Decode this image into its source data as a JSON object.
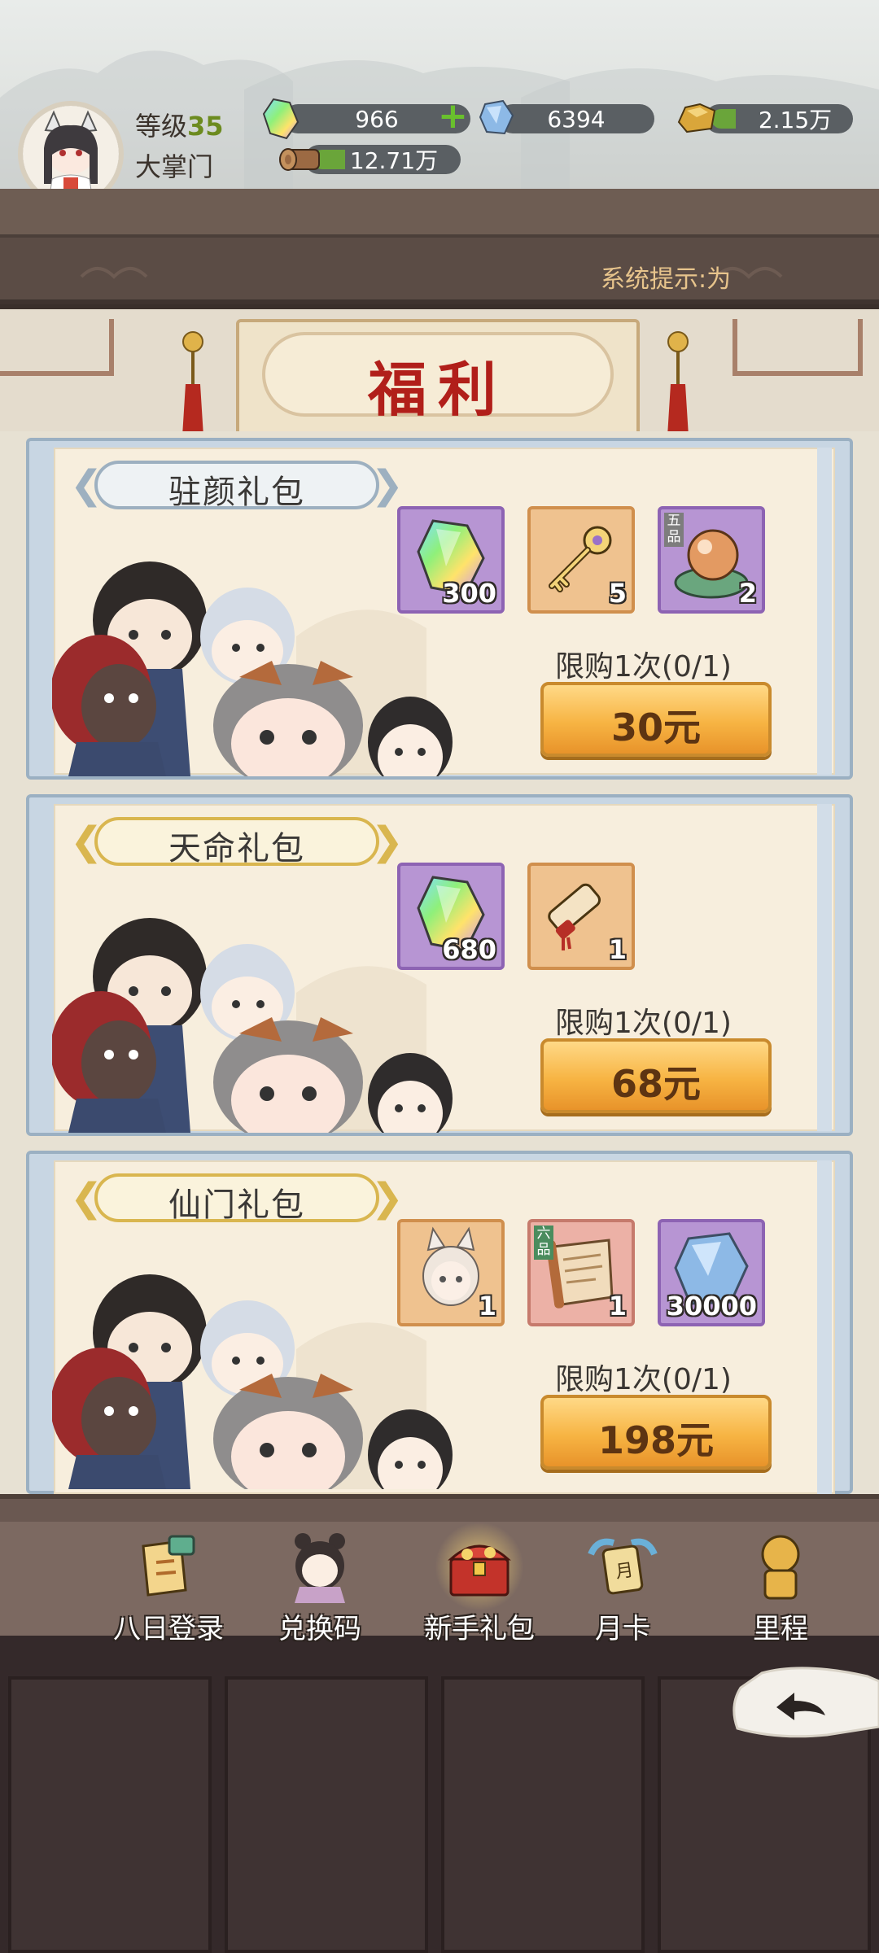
{
  "header": {
    "level_label": "等级",
    "level_value": "35",
    "player_title": "大掌门",
    "resources": {
      "gem": "966",
      "crystal": "6394",
      "gold": "2.15万",
      "wood": "12.71万"
    },
    "system_notice": "系统提示:为"
  },
  "page_title": "福利",
  "packs": [
    {
      "name": "驻颜礼包",
      "items": [
        {
          "icon": "rainbow-gem-icon",
          "count": "300"
        },
        {
          "icon": "golden-key-icon",
          "count": "5"
        },
        {
          "icon": "pearl-orb-icon",
          "count": "2",
          "grade": "五品"
        }
      ],
      "limit": "限购1次(0/1)",
      "price": "30元"
    },
    {
      "name": "天命礼包",
      "items": [
        {
          "icon": "rainbow-gem-icon",
          "count": "680"
        },
        {
          "icon": "scroll-icon",
          "count": "1"
        }
      ],
      "limit": "限购1次(0/1)",
      "price": "68元"
    },
    {
      "name": "仙门礼包",
      "items": [
        {
          "icon": "fox-girl-portrait-icon",
          "count": "1"
        },
        {
          "icon": "open-scroll-icon",
          "count": "1",
          "grade": "六品"
        },
        {
          "icon": "blue-crystal-icon",
          "count": "30000"
        }
      ],
      "limit": "限购1次(0/1)",
      "price": "198元"
    }
  ],
  "nav": [
    {
      "label": "八日登录",
      "icon": "login-scroll-icon"
    },
    {
      "label": "兑换码",
      "icon": "code-girl-icon"
    },
    {
      "label": "新手礼包",
      "icon": "treasure-chest-icon",
      "active": true
    },
    {
      "label": "月卡",
      "icon": "month-card-icon"
    },
    {
      "label": "里程",
      "icon": "milestone-icon"
    }
  ],
  "colors": {
    "accent_gold": "#f7b443",
    "title_red": "#b11f1a",
    "level_green": "#6c8b1f",
    "card_blue": "#c8d6e3"
  }
}
